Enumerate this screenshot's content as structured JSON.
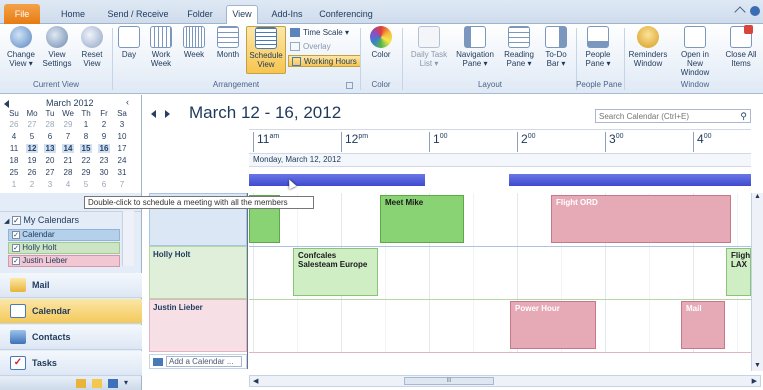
{
  "tabs": [
    {
      "label": "File"
    },
    {
      "label": "Home"
    },
    {
      "label": "Send / Receive"
    },
    {
      "label": "Folder"
    },
    {
      "label": "View"
    },
    {
      "label": "Add-Ins"
    },
    {
      "label": "Conferencing"
    }
  ],
  "ribbon": {
    "current_view": {
      "change_view": "Change View ▾",
      "view_settings": "View Settings",
      "reset_view": "Reset View",
      "group": "Current View"
    },
    "arrangement": {
      "day": "Day",
      "work_week": "Work Week",
      "week": "Week",
      "month": "Month",
      "schedule_view": "Schedule View",
      "time_scale": "Time Scale ▾",
      "overlay": "Overlay",
      "working_hours": "Working Hours",
      "group": "Arrangement"
    },
    "color": {
      "label": "Color",
      "group": "Color"
    },
    "layout": {
      "daily_task_list": "Daily Task List ▾",
      "navigation_pane": "Navigation Pane ▾",
      "reading_pane": "Reading Pane ▾",
      "todo_bar": "To-Do Bar ▾",
      "group": "Layout"
    },
    "people_pane": {
      "label": "People Pane ▾",
      "group": "People Pane"
    },
    "window": {
      "reminders": "Reminders Window",
      "open_new": "Open in New Window",
      "close_all": "Close All Items",
      "group": "Window"
    }
  },
  "mini_calendar": {
    "month": "March 2012",
    "weekdays": [
      "Su",
      "Mo",
      "Tu",
      "We",
      "Th",
      "Fr",
      "Sa"
    ],
    "weeks": [
      [
        "26",
        "27",
        "28",
        "29",
        "1",
        "2",
        "3"
      ],
      [
        "4",
        "5",
        "6",
        "7",
        "8",
        "9",
        "10"
      ],
      [
        "11",
        "12",
        "13",
        "14",
        "15",
        "16",
        "17"
      ],
      [
        "18",
        "19",
        "20",
        "21",
        "22",
        "23",
        "24"
      ],
      [
        "25",
        "26",
        "27",
        "28",
        "29",
        "30",
        "31"
      ],
      [
        "1",
        "2",
        "3",
        "4",
        "5",
        "6",
        "7"
      ]
    ]
  },
  "tooltip": "Double-click to schedule a meeting with all the members",
  "calendars": {
    "group": "My Calendars",
    "items": [
      {
        "label": "Calendar"
      },
      {
        "label": "Holly Holt"
      },
      {
        "label": "Justin Lieber"
      }
    ]
  },
  "nav": {
    "mail": "Mail",
    "calendar": "Calendar",
    "contacts": "Contacts",
    "tasks": "Tasks"
  },
  "main": {
    "date_range": "March 12 - 16, 2012",
    "search_placeholder": "Search Calendar (Ctrl+E)",
    "day_label": "Monday, March 12, 2012",
    "hours": [
      {
        "h": "11",
        "m": "am"
      },
      {
        "h": "12",
        "m": "pm"
      },
      {
        "h": "1",
        "m": "00"
      },
      {
        "h": "2",
        "m": "00"
      },
      {
        "h": "3",
        "m": "00"
      },
      {
        "h": "4",
        "m": "00"
      }
    ],
    "rows": [
      {
        "name": ""
      },
      {
        "name": "Holly Holt"
      },
      {
        "name": "Justin Lieber"
      }
    ],
    "appointments": [
      {
        "title": "Meet Mike"
      },
      {
        "title": "Flight ORD"
      },
      {
        "title": "Confcales Salesteam Europe"
      },
      {
        "title": "Flight LAX"
      },
      {
        "title": "Power Hour"
      },
      {
        "title": "Mail"
      }
    ],
    "add_calendar": "Add a Calendar ...",
    "scroll_mark": "III"
  }
}
